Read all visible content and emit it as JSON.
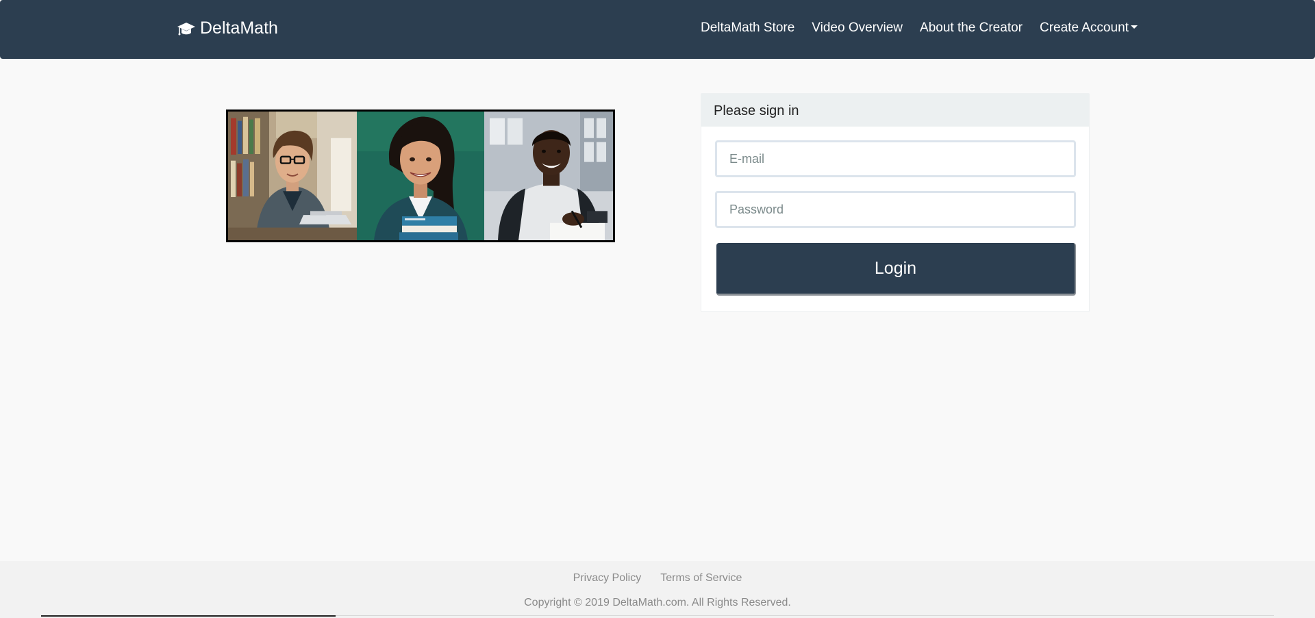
{
  "navbar": {
    "brand_icon": "graduation-cap-icon",
    "brand_name": "DeltaMath",
    "links": [
      {
        "label": "DeltaMath Store"
      },
      {
        "label": "Video Overview"
      },
      {
        "label": "About the Creator"
      },
      {
        "label": "Create Account",
        "dropdown_icon": "caret-down-icon"
      }
    ],
    "background_color": "#2c3e50"
  },
  "hero": {
    "panels": [
      "student-with-laptop",
      "student-holding-books",
      "student-writing"
    ]
  },
  "signin": {
    "heading": "Please sign in",
    "email": {
      "value": "",
      "placeholder": "E-mail"
    },
    "password": {
      "value": "",
      "placeholder": "Password"
    },
    "login_label": "Login"
  },
  "footer": {
    "privacy_label": "Privacy Policy",
    "terms_label": "Terms of Service",
    "copyright": "Copyright © 2019 DeltaMath.com. All Rights Reserved."
  }
}
